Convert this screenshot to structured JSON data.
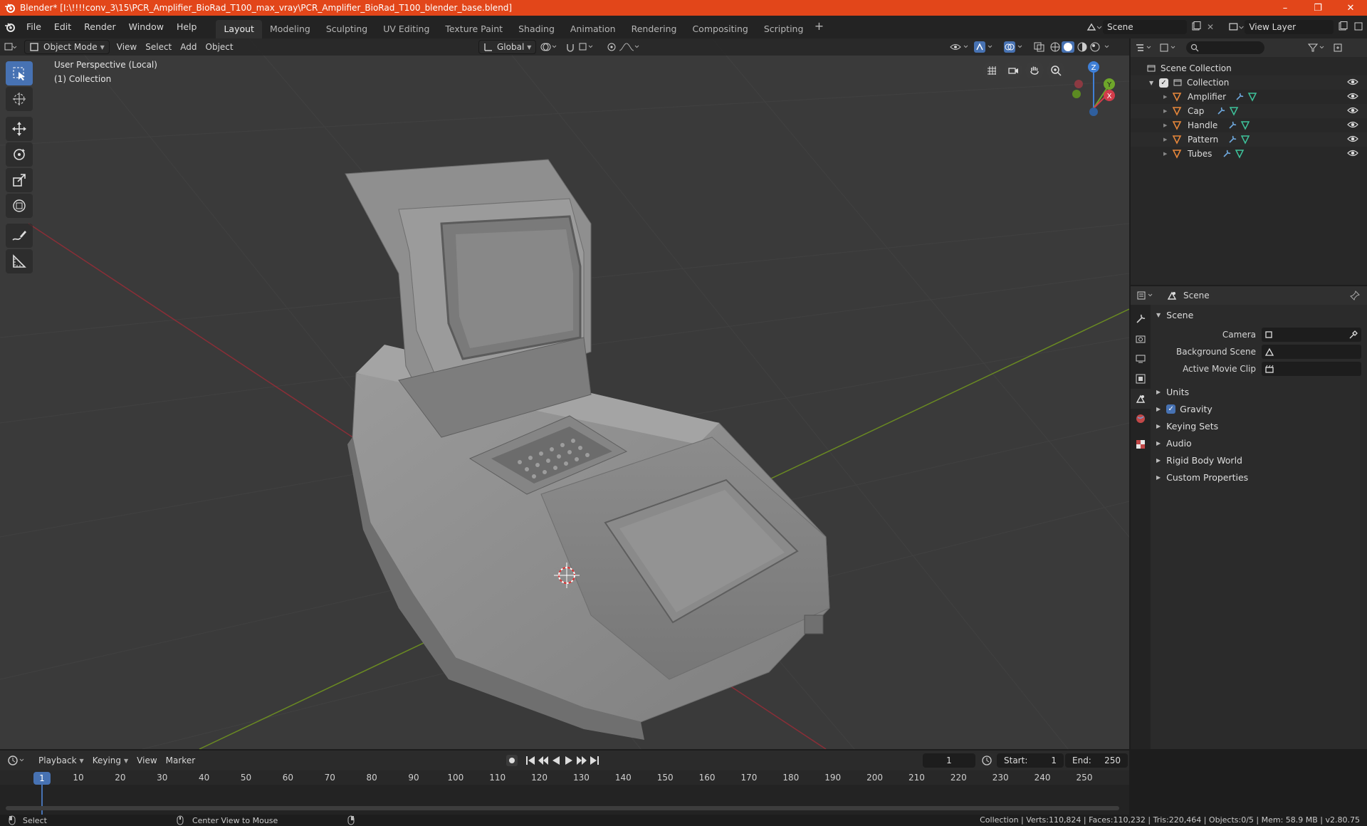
{
  "window": {
    "title": "Blender* [I:\\!!!!conv_3\\15\\PCR_Amplifier_BioRad_T100_max_vray\\PCR_Amplifier_BioRad_T100_blender_base.blend]",
    "minimize": "–",
    "maximize": "❐",
    "close": "✕"
  },
  "menu": [
    "File",
    "Edit",
    "Render",
    "Window",
    "Help"
  ],
  "workspaces": [
    "Layout",
    "Modeling",
    "Sculpting",
    "UV Editing",
    "Texture Paint",
    "Shading",
    "Animation",
    "Rendering",
    "Compositing",
    "Scripting"
  ],
  "active_workspace": "Layout",
  "scene_name": "Scene",
  "view_layer": "View Layer",
  "viewport": {
    "mode": "Object Mode",
    "menus": [
      "View",
      "Select",
      "Add",
      "Object"
    ],
    "orientation": "Global",
    "info_line1": "User Perspective (Local)",
    "info_line2": "(1) Collection",
    "gizmo": {
      "x": "X",
      "y": "Y",
      "z": "Z"
    }
  },
  "outliner": {
    "root": "Scene Collection",
    "collection": "Collection",
    "objects": [
      "Amplifier",
      "Cap",
      "Handle",
      "Pattern",
      "Tubes"
    ]
  },
  "properties": {
    "header": "Scene",
    "section": "Scene",
    "fields": [
      {
        "label": "Camera"
      },
      {
        "label": "Background Scene"
      },
      {
        "label": "Active Movie Clip"
      }
    ],
    "panels": [
      "Units",
      "Gravity",
      "Keying Sets",
      "Audio",
      "Rigid Body World",
      "Custom Properties"
    ]
  },
  "timeline": {
    "menus": [
      "Playback",
      "Keying",
      "View",
      "Marker"
    ],
    "current_frame": "1",
    "start_label": "Start:",
    "start": "1",
    "end_label": "End:",
    "end": "250",
    "ticks": [
      "10",
      "20",
      "30",
      "40",
      "50",
      "60",
      "70",
      "80",
      "90",
      "100",
      "110",
      "120",
      "130",
      "140",
      "150",
      "160",
      "170",
      "180",
      "190",
      "200",
      "210",
      "220",
      "230",
      "240",
      "250"
    ],
    "playhead": "1"
  },
  "status": {
    "left": "Select",
    "middle": "Center View to Mouse",
    "right": "Collection | Verts:110,824 | Faces:110,232 | Tris:220,464 | Objects:0/5 | Mem: 58.9 MB | v2.80.75"
  },
  "colors": {
    "titlebar": "#e2461a",
    "accent": "#4772b3",
    "object_icon": "#e8873a",
    "modifier_icon": "#6fa8dc",
    "mesh_icon": "#3ec39b"
  }
}
